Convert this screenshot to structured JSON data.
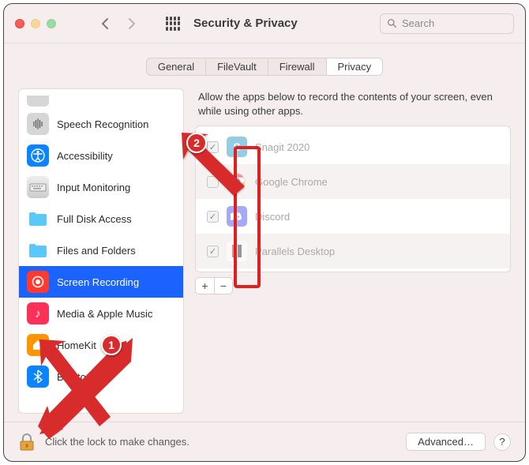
{
  "window": {
    "title": "Security & Privacy"
  },
  "search": {
    "placeholder": "Search"
  },
  "tabs": {
    "general": "General",
    "filevault": "FileVault",
    "firewall": "Firewall",
    "privacy": "Privacy"
  },
  "sidebar": {
    "items": [
      {
        "label": "Speech Recognition",
        "icon": "mic"
      },
      {
        "label": "Accessibility",
        "icon": "accessibility"
      },
      {
        "label": "Input Monitoring",
        "icon": "keyboard"
      },
      {
        "label": "Full Disk Access",
        "icon": "folder"
      },
      {
        "label": "Files and Folders",
        "icon": "folder"
      },
      {
        "label": "Screen Recording",
        "icon": "record",
        "selected": true
      },
      {
        "label": "Media & Apple Music",
        "icon": "music"
      },
      {
        "label": "HomeKit",
        "icon": "home"
      },
      {
        "label": "Bluetooth",
        "icon": "bluetooth"
      }
    ]
  },
  "right": {
    "description": "Allow the apps below to record the contents of your screen, even while using other apps.",
    "apps": [
      {
        "name": "Snagit 2020",
        "checked": true,
        "color": "#3aa6d0",
        "glyph": "S"
      },
      {
        "name": "Google Chrome",
        "checked": false,
        "color": "#ffffff",
        "glyph": "◐"
      },
      {
        "name": "Discord",
        "checked": true,
        "color": "#5865f2",
        "glyph": "⌁"
      },
      {
        "name": "Parallels Desktop",
        "checked": true,
        "color": "#d63a2f",
        "glyph": "‖"
      }
    ],
    "add": "+",
    "remove": "−"
  },
  "footer": {
    "lock_text": "Click the lock to make changes.",
    "advanced": "Advanced…",
    "help": "?"
  },
  "annotations": {
    "badge1": "1",
    "badge2": "2"
  }
}
